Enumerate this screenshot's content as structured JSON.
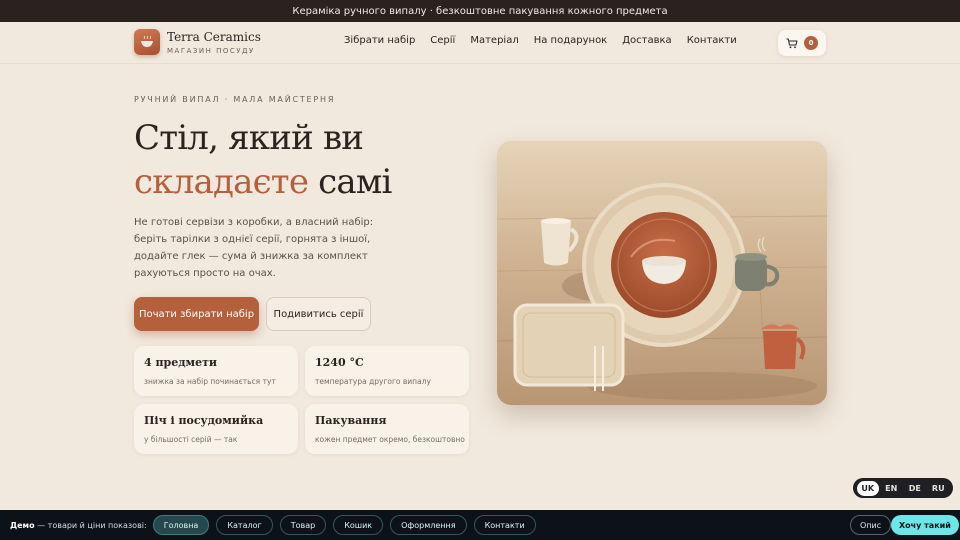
{
  "announcement": "Кераміка ручного випалу · безкоштовне пакування кожного предмета",
  "brand": {
    "name": "Terra Ceramics",
    "tagline": "МАГАЗИН ПОСУДУ"
  },
  "nav": [
    "Зібрати набір",
    "Серії",
    "Матеріал",
    "На подарунок",
    "Доставка",
    "Контакти"
  ],
  "cart": {
    "count": "0"
  },
  "hero": {
    "eyebrow": "РУЧНИЙ ВИПАЛ · МАЛА МАЙСТЕРНЯ",
    "title_line1": "Стіл, який ви",
    "title_accent": "складаєте",
    "title_rest": " самі",
    "lead": "Не готові сервізи з коробки, а власний набір: беріть тарілки з однієї серії, горнята з іншої, додайте глек — сума й знижка за комплект рахуються просто на очах.",
    "primary_button": "Почати збирати набір",
    "secondary_button": "Подивитись серії"
  },
  "features": [
    {
      "title": "4 предмети",
      "desc": "знижка за набір починається тут"
    },
    {
      "title": "1240 °C",
      "desc": "температура другого випалу"
    },
    {
      "title": "Піч і посудомийка",
      "desc": "у більшості серій — так"
    },
    {
      "title": "Пакування",
      "desc": "кожен предмет окремо, безкоштовно"
    }
  ],
  "languages": {
    "items": [
      "UK",
      "EN",
      "DE",
      "RU"
    ],
    "active": "UK"
  },
  "demo_bar": {
    "label_bold": "Демо",
    "label_rest": " — товари й ціни показові:",
    "pages": [
      "Головна",
      "Каталог",
      "Товар",
      "Кошик",
      "Оформлення",
      "Контакти"
    ],
    "active_page": "Головна",
    "about": "Опис",
    "cta": "Хочу такий"
  },
  "colors": {
    "accent": "#b5603c",
    "background": "#f2e9de",
    "dark": "#2b2220",
    "demo_cta": "#6ce6e6"
  },
  "icons": {
    "logo": "bowl-icon",
    "cart": "cart-icon"
  }
}
